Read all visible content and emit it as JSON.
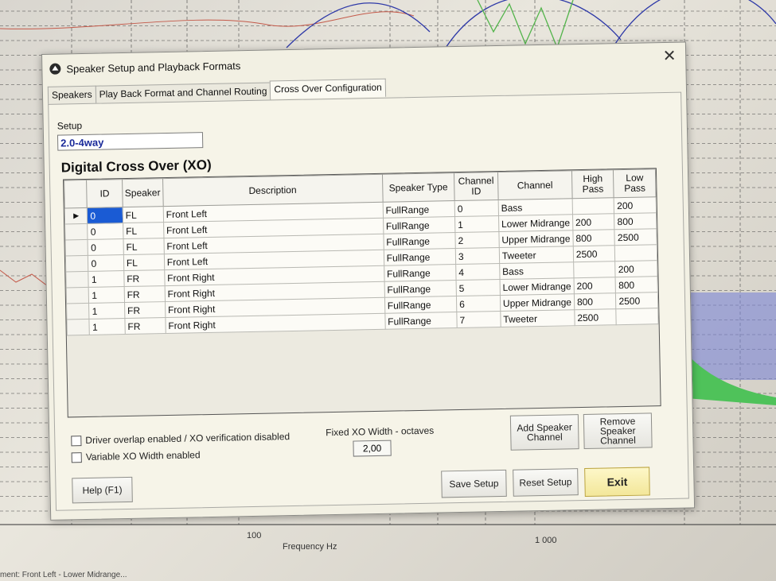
{
  "background": {
    "x_tick_left": "100",
    "x_tick_right": "1 000",
    "x_axis_label": "Frequency Hz",
    "status": "ment: Front Left - Lower Midrange..."
  },
  "dialog": {
    "title": "Speaker Setup and Playback Formats",
    "close_glyph": "✕",
    "tabs": [
      "Speakers",
      "Play Back Format and Channel Routing",
      "Cross Over Configuration"
    ],
    "active_tab": 2,
    "setup_label": "Setup",
    "setup_value": "2.0-4way",
    "section_title": "Digital Cross Over (XO)",
    "table": {
      "headers": [
        "ID",
        "Speaker",
        "Description",
        "Speaker Type",
        "Channel ID",
        "Channel",
        "High Pass",
        "Low Pass"
      ],
      "rows": [
        [
          "0",
          "FL",
          "Front Left",
          "FullRange",
          "0",
          "Bass",
          "",
          "200"
        ],
        [
          "0",
          "FL",
          "Front Left",
          "FullRange",
          "1",
          "Lower Midrange",
          "200",
          "800"
        ],
        [
          "0",
          "FL",
          "Front Left",
          "FullRange",
          "2",
          "Upper Midrange",
          "800",
          "2500"
        ],
        [
          "0",
          "FL",
          "Front Left",
          "FullRange",
          "3",
          "Tweeter",
          "2500",
          ""
        ],
        [
          "1",
          "FR",
          "Front Right",
          "FullRange",
          "4",
          "Bass",
          "",
          "200"
        ],
        [
          "1",
          "FR",
          "Front Right",
          "FullRange",
          "5",
          "Lower Midrange",
          "200",
          "800"
        ],
        [
          "1",
          "FR",
          "Front Right",
          "FullRange",
          "6",
          "Upper Midrange",
          "800",
          "2500"
        ],
        [
          "1",
          "FR",
          "Front Right",
          "FullRange",
          "7",
          "Tweeter",
          "2500",
          ""
        ]
      ],
      "current_row_marker": "▶"
    },
    "checkbox_overlap": "Driver overlap enabled / XO verification disabled",
    "checkbox_variable": "Variable XO Width enabled",
    "xo_width_label": "Fixed XO Width - octaves",
    "xo_width_value": "2,00",
    "add_button": "Add Speaker Channel",
    "remove_button": "Remove Speaker Channel",
    "help_button": "Help (F1)",
    "save_button": "Save Setup",
    "reset_button": "Reset Setup",
    "exit_button": "Exit"
  }
}
